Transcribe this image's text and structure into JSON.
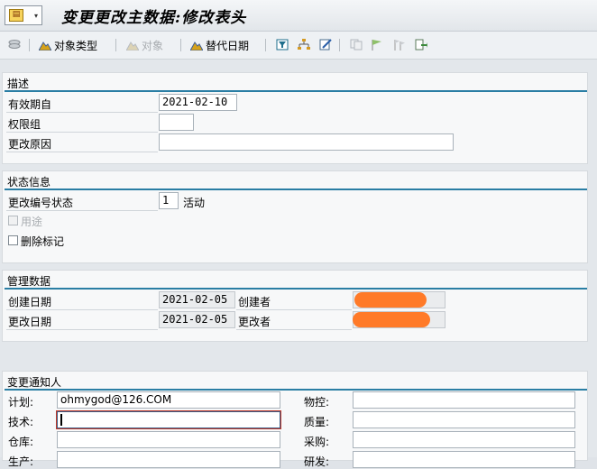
{
  "window": {
    "title": "变更更改主数据:修改表头"
  },
  "toolbar": {
    "object_type": "对象类型",
    "object": "对象",
    "alt_date": "替代日期"
  },
  "colors": {
    "accent": "#2a7ea4",
    "redaction": "#ff7a28"
  },
  "description": {
    "title": "描述",
    "valid_from_label": "有效期自",
    "valid_from_value": "2021-02-10",
    "auth_group_label": "权限组",
    "auth_group_value": "",
    "reason_label": "更改原因",
    "reason_value": ""
  },
  "status": {
    "title": "状态信息",
    "change_no_status_label": "更改编号状态",
    "change_no_status_value": "1",
    "change_no_status_text": "活动",
    "usage_label": "用途",
    "deletion_flag_label": "删除标记"
  },
  "admin": {
    "title": "管理数据",
    "created_on_label": "创建日期",
    "created_on_value": "2021-02-05",
    "created_by_label": "创建者",
    "changed_on_label": "更改日期",
    "changed_on_value": "2021-02-05",
    "changed_by_label": "更改者"
  },
  "notify": {
    "title": "变更通知人",
    "plan_label": "计划:",
    "plan_value": "ohmygod@126.COM",
    "tech_label": "技术:",
    "tech_value": "",
    "warehouse_label": "仓库:",
    "warehouse_value": "",
    "production_label": "生产:",
    "material_control_label": "物控:",
    "quality_label": "质量:",
    "purchase_label": "采购:",
    "rnd_label": "研发:"
  }
}
